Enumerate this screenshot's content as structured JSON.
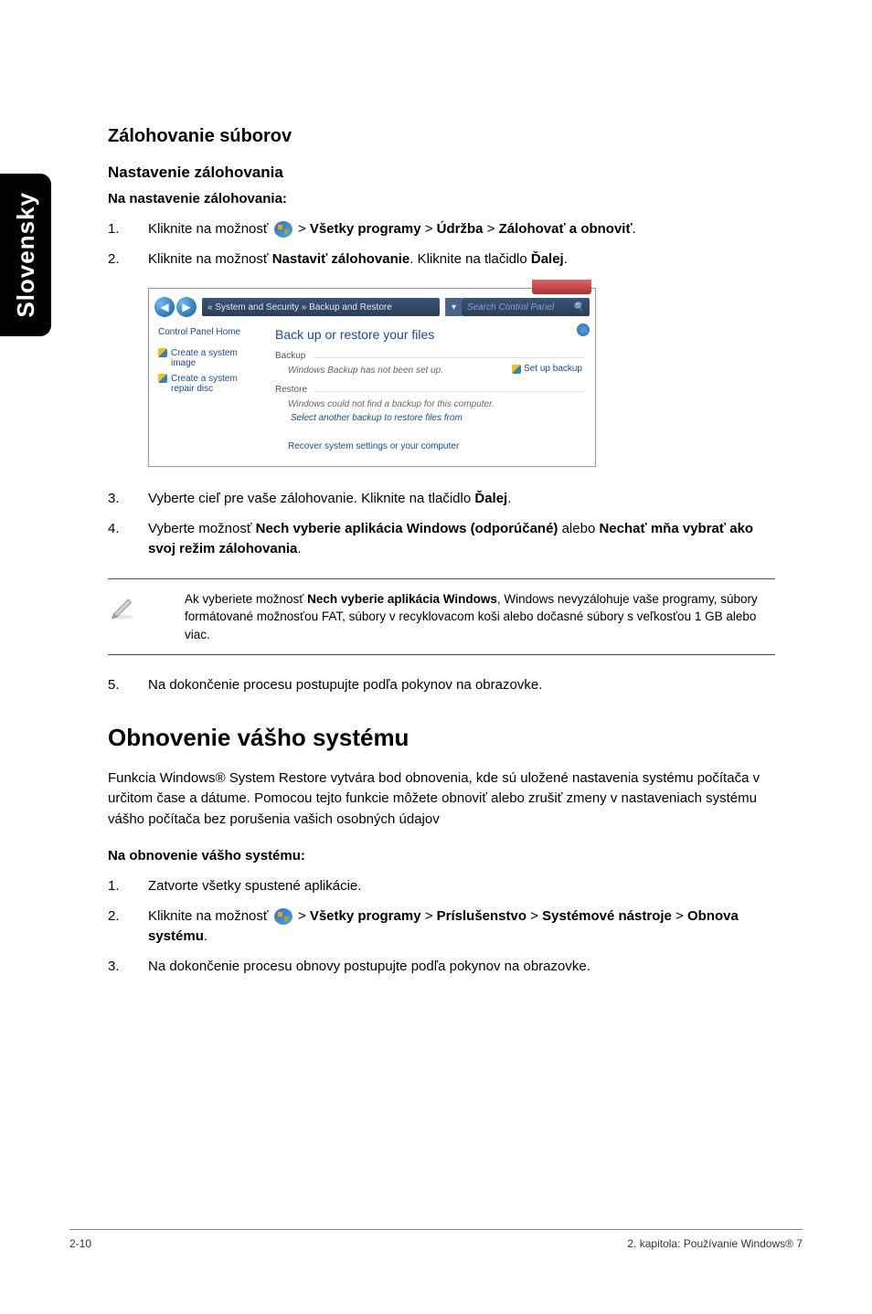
{
  "side_tab": "Slovensky",
  "section": {
    "title": "Zálohovanie súborov",
    "sub": "Nastavenie zálohovania",
    "sub2": "Na nastavenie zálohovania:"
  },
  "steps1": [
    {
      "num": "1.",
      "pre": "Kliknite na možnosť ",
      "post": " > ",
      "b1": "Všetky programy",
      "sep1": " > ",
      "b2": "Údržba",
      "sep2": " > ",
      "b3": "Zálohovať a obnoviť",
      "end": "."
    },
    {
      "num": "2.",
      "pre": "Kliknite na možnosť ",
      "b1": "Nastaviť zálohovanie",
      "mid": ". Kliknite na tlačidlo ",
      "b2": "Ďalej",
      "end": "."
    }
  ],
  "screenshot": {
    "breadcrumb": "« System and Security » Backup and Restore",
    "search_placeholder": "Search Control Panel",
    "search_icon": "🔍",
    "cph": "Control Panel Home",
    "side_link1": "Create a system image",
    "side_link2": "Create a system repair disc",
    "main_title": "Back up or restore your files",
    "backup_label": "Backup",
    "backup_text": "Windows Backup has not been set up.",
    "setup_link": "Set up backup",
    "restore_label": "Restore",
    "restore_text": "Windows could not find a backup for this computer.",
    "restore_link": "Select another backup to restore files from",
    "recover_link": "Recover system settings or your computer"
  },
  "steps2": [
    {
      "num": "3.",
      "pre": "Vyberte cieľ pre vaše zálohovanie.  Kliknite na tlačidlo ",
      "b1": "Ďalej",
      "end": "."
    },
    {
      "num": "4.",
      "pre": "Vyberte možnosť ",
      "b1": "Nech vyberie aplikácia Windows (odporúčané)",
      "mid": " alebo ",
      "b2": "Nechať mňa vybrať ako svoj režim zálohovania",
      "end": "."
    }
  ],
  "note": {
    "pre": "Ak vyberiete možnosť ",
    "bold": "Nech vyberie aplikácia Windows",
    "post": ", Windows nevyzálohuje vaše programy, súbory formátované možnosťou FAT, súbory v recyklovacom koši alebo dočasné súbory s veľkosťou 1 GB alebo viac."
  },
  "steps3": [
    {
      "num": "5.",
      "txt": "Na dokončenie procesu postupujte podľa pokynov na obrazovke."
    }
  ],
  "restore": {
    "title": "Obnovenie vášho systému",
    "para": "Funkcia Windows® System Restore vytvára bod obnovenia, kde sú uložené nastavenia systému počítača v určitom čase a dátume. Pomocou tejto funkcie môžete obnoviť alebo zrušiť zmeny v nastaveniach systému vášho počítača bez porušenia vašich osobných údajov",
    "sub": "Na obnovenie vášho systému:"
  },
  "steps4": [
    {
      "num": "1.",
      "txt": "Zatvorte všetky spustené aplikácie."
    },
    {
      "num": "2.",
      "pre": "Kliknite na možnosť ",
      "post": " > ",
      "b1": "Všetky programy",
      "sep1": " > ",
      "b2": "Príslušenstvo",
      "sep2": " > ",
      "b3": "Systémové nástroje",
      "sep3": " > ",
      "b4": "Obnova systému",
      "end": "."
    },
    {
      "num": "3.",
      "txt": "Na dokončenie procesu obnovy postupujte podľa pokynov na obrazovke."
    }
  ],
  "footer": {
    "left": "2-10",
    "right": "2. kapitola: Používanie Windows® 7"
  }
}
